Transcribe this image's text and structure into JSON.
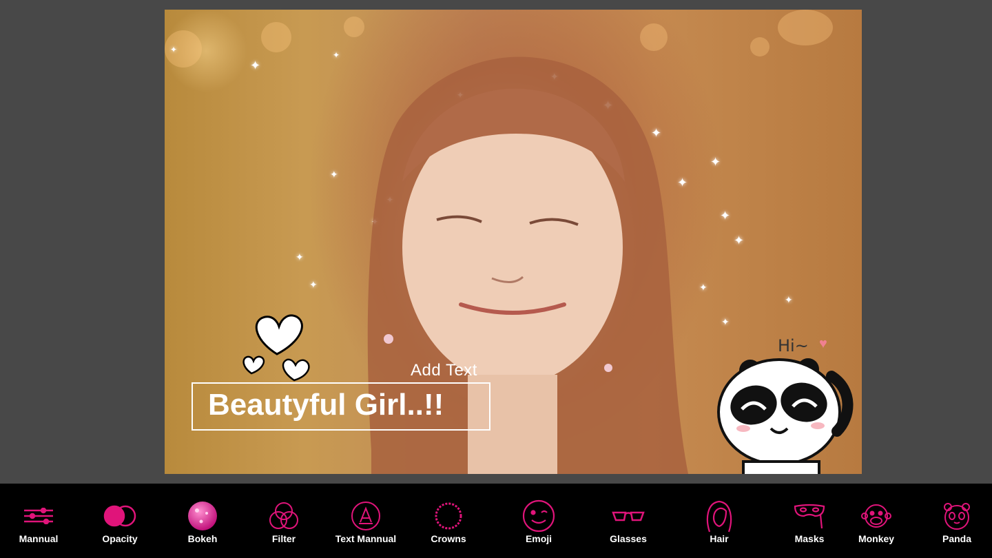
{
  "canvas": {
    "add_text_label": "Add Text",
    "title_text": "Beautyful Girl..!!",
    "sticker_caption": "Hi~"
  },
  "toolbar": {
    "accent_color": "#e0147a",
    "items": [
      {
        "label": "Mannual",
        "icon": "sliders-icon"
      },
      {
        "label": "Opacity",
        "icon": "opacity-icon"
      },
      {
        "label": "Bokeh",
        "icon": "bokeh-icon"
      },
      {
        "label": "Filter",
        "icon": "filter-icon"
      },
      {
        "label": "Text Mannual",
        "icon": "text-icon"
      },
      {
        "label": "Crowns",
        "icon": "crown-wreath-icon"
      },
      {
        "label": "Emoji",
        "icon": "wink-emoji-icon"
      },
      {
        "label": "Glasses",
        "icon": "glasses-icon"
      },
      {
        "label": "Hair",
        "icon": "hair-icon"
      },
      {
        "label": "Masks",
        "icon": "mask-icon"
      },
      {
        "label": "Monkey",
        "icon": "monkey-icon"
      },
      {
        "label": "Panda",
        "icon": "panda-icon"
      }
    ]
  }
}
